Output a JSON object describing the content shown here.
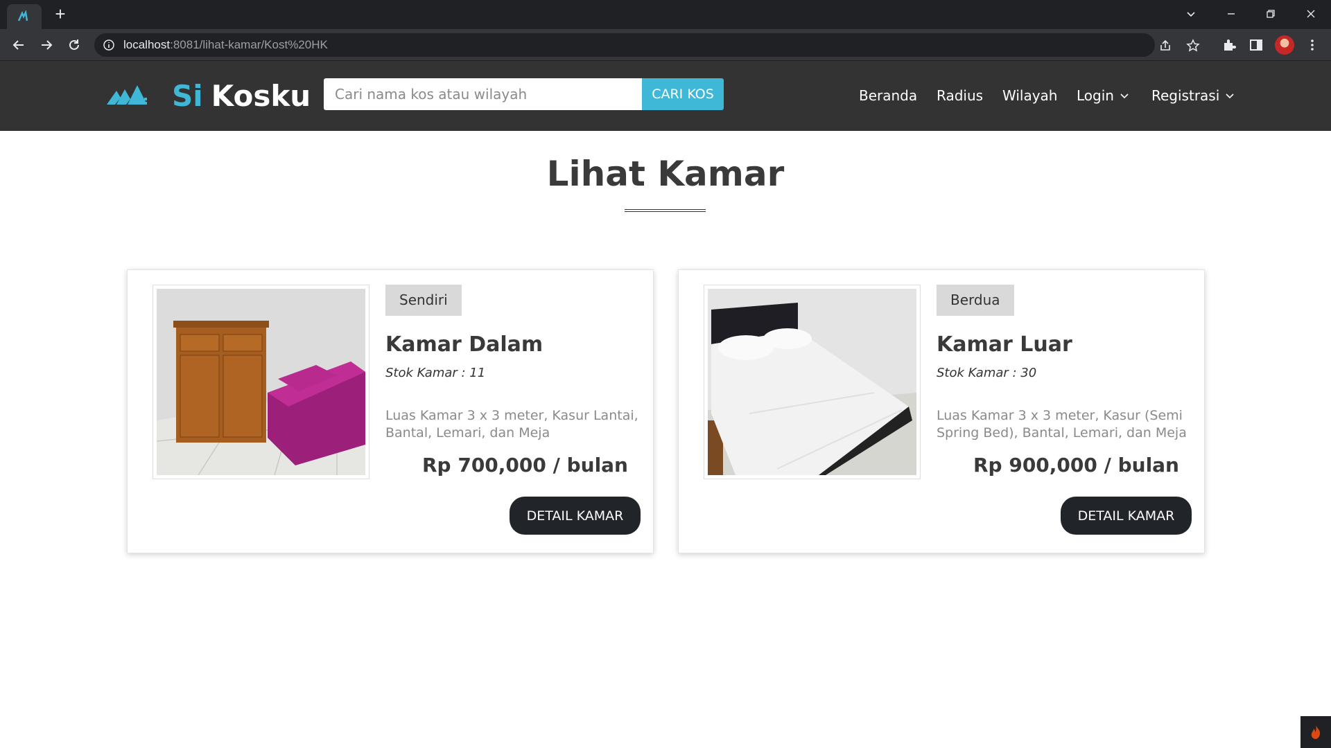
{
  "browser": {
    "url_host": "localhost",
    "url_path": ":8081/lihat-kamar/Kost%20HK"
  },
  "site": {
    "brand_part1": "Si",
    "brand_part2": "Kosku",
    "search_placeholder": "Cari nama kos atau wilayah",
    "search_button": "CARI KOS",
    "nav": [
      "Beranda",
      "Radius",
      "Wilayah",
      "Login",
      "Registrasi"
    ]
  },
  "page": {
    "title": "Lihat Kamar"
  },
  "rooms": [
    {
      "type": "Sendiri",
      "name": "Kamar Dalam",
      "stock": "Stok Kamar : 11",
      "description": "Luas Kamar 3 x 3 meter, Kasur Lantai, Bantal, Lemari, dan Meja",
      "price": "Rp 700,000 / bulan",
      "button": "DETAIL KAMAR"
    },
    {
      "type": "Berdua",
      "name": "Kamar Luar",
      "stock": "Stok Kamar : 30",
      "description": "Luas Kamar 3 x 3 meter, Kasur (Semi Spring Bed), Bantal, Lemari, dan Meja",
      "price": "Rp 900,000 / bulan",
      "button": "DETAIL KAMAR"
    }
  ],
  "colors": {
    "accent": "#3fb8d8",
    "navbar": "#333333",
    "button_dark": "#212529"
  }
}
